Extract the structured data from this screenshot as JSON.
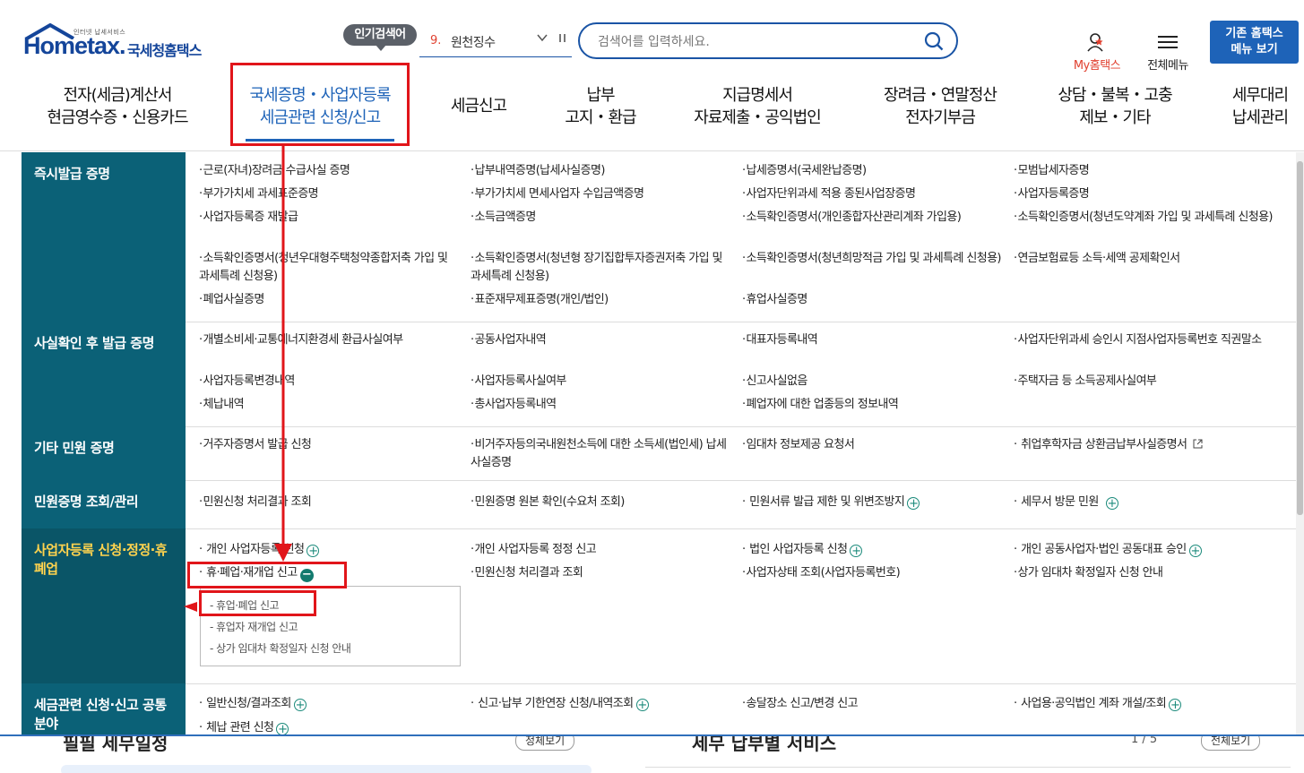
{
  "header": {
    "logo": {
      "sub": "인터넷 납세서비스",
      "brand": "Hometax.",
      "brand_kr": "국세청홈택스"
    },
    "popular": {
      "badge": "인기검색어",
      "rank": "9.",
      "term": "원천징수"
    },
    "search": {
      "placeholder": "검색어를 입력하세요."
    },
    "my_home": "My홈택스",
    "all_menu": "전체메뉴",
    "legacy_btn": {
      "line1": "기존 홈택스",
      "line2": "메뉴 보기"
    }
  },
  "gnb": [
    {
      "l1": "전자(세금)계산서",
      "l2": "현금영수증・신용카드"
    },
    {
      "l1": "국세증명・사업자등록",
      "l2": "세금관련 신청/신고"
    },
    {
      "l1": "세금신고",
      "l2": ""
    },
    {
      "l1": "납부",
      "l2": "고지・환급"
    },
    {
      "l1": "지급명세서",
      "l2": "자료제출・공익법인"
    },
    {
      "l1": "장려금・연말정산",
      "l2": "전자기부금"
    },
    {
      "l1": "상담・불복・고충",
      "l2": "제보・기타"
    },
    {
      "l1": "세무대리",
      "l2": "납세관리"
    }
  ],
  "menu": {
    "cats": [
      "즉시발급 증명",
      "사실확인 후 발급 증명",
      "기타 민원 증명",
      "민원증명 조회/관리",
      "사업자등록 신청·정정·휴폐업",
      "세금관련 신청·신고 공통분야"
    ],
    "r1": [
      "근로(자녀)장려금 수급사실 증명",
      "납부내역증명(납세사실증명)",
      "납세증명서(국세완납증명)",
      "모범납세자증명",
      "부가가치세 과세표준증명",
      "부가가치세 면세사업자 수입금액증명",
      "사업자단위과세 적용 종된사업장증명",
      "사업자등록증명",
      "사업자등록증 재발급",
      "소득금액증명",
      "소득확인증명서(개인종합자산관리계좌 가입용)",
      "소득확인증명서(청년도약계좌 가입 및 과세특례 신청용)",
      "소득확인증명서(청년우대형주택청약종합저축 가입 및 과세특례 신청용)",
      "소득확인증명서(청년형 장기집합투자증권저축 가입 및 과세특례 신청용)",
      "소득확인증명서(청년희망적금 가입 및 과세특례 신청용)",
      "연금보험료등 소득·세액 공제확인서",
      "폐업사실증명",
      "표준재무제표증명(개인/법인)",
      "휴업사실증명"
    ],
    "r2": [
      "개별소비세·교통에너지환경세 환급사실여부",
      "공동사업자내역",
      "대표자등록내역",
      "사업자단위과세 승인시 지점사업자등록번호 직권말소",
      "사업자등록변경내역",
      "사업자등록사실여부",
      "신고사실없음",
      "주택자금 등 소득공제사실여부",
      "체납내역",
      "총사업자등록내역",
      "폐업자에 대한 업종등의 정보내역"
    ],
    "r3": [
      "거주자증명서 발급 신청",
      "비거주자등의국내원천소득에 대한 소득세(법인세) 납세사실증명",
      "임대차 정보제공 요청서",
      "취업후학자금 상환금납부사실증명서"
    ],
    "r4": [
      "민원신청 처리결과 조회",
      "민원증명 원본 확인(수요처 조회)",
      "민원서류 발급 제한 및 위변조방지",
      "세무서 방문 민원"
    ],
    "r5": [
      "개인 사업자등록 신청",
      "개인 사업자등록 정정 신고",
      "법인 사업자등록 신청",
      "개인 공동사업자·법인 공동대표 승인",
      "휴·폐업·재개업 신고",
      "민원신청 처리결과 조회",
      "사업자상태 조회(사업자등록번호)",
      "상가 임대차 확정일자 신청 안내"
    ],
    "r5_sub": [
      "휴업·폐업 신고",
      "휴업자 재개업 신고",
      "상가 임대차 확정일자 신청 안내"
    ],
    "r6": [
      "일반신청/결과조회",
      "신고·납부 기한연장 신청/내역조회",
      "송달장소 신고/변경 신고",
      "사업용·공익법인 계좌 개설/조회",
      "체납 관련 신청"
    ]
  },
  "behind": {
    "title_left": "필필 세무일정",
    "btn_left": "정체보기",
    "title_right": "세무 납부별 서비스",
    "page": "1 / 5",
    "btn_right": "전체보기"
  },
  "colors": {
    "primary": "#1e63b8",
    "category_bg": "#0b6177",
    "highlight": "#e1151a",
    "active_cat_text": "#ffd34e"
  }
}
